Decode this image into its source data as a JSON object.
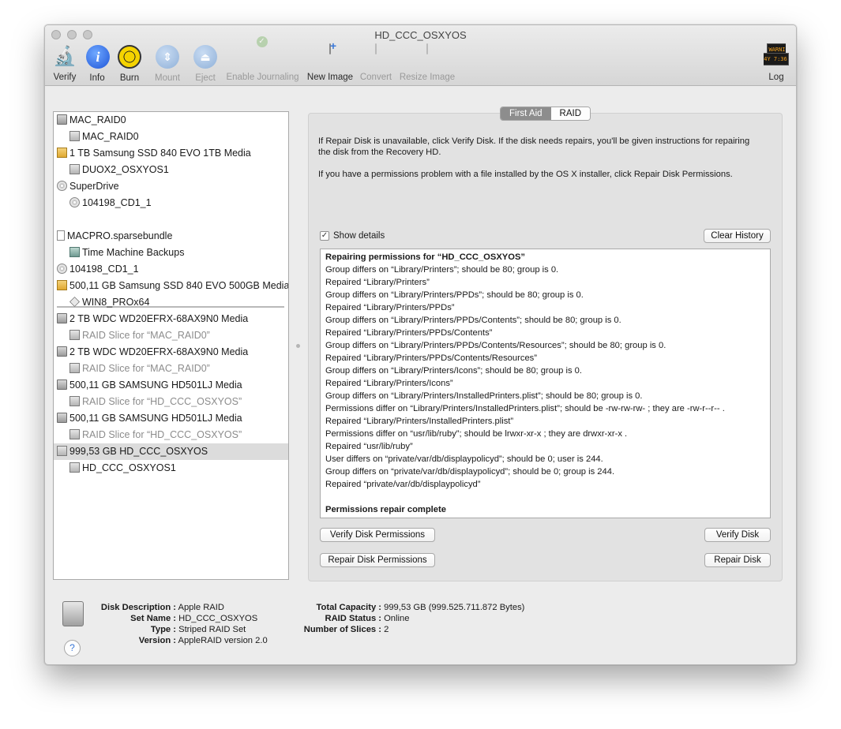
{
  "window": {
    "title": "HD_CCC_OSXYOS"
  },
  "toolbar": {
    "verify": "Verify",
    "info": "Info",
    "burn": "Burn",
    "mount": "Mount",
    "eject": "Eject",
    "enable_journaling": "Enable Journaling",
    "new_image": "New Image",
    "convert": "Convert",
    "resize_image": "Resize Image",
    "log": "Log",
    "log_icon_text": "WARNI\n4Y 7:36"
  },
  "sidebar": {
    "items": [
      {
        "label": "MAC_RAID0",
        "icon": "hard-disk-icon"
      },
      {
        "label": "MAC_RAID0",
        "icon": "volume-icon"
      },
      {
        "label": "1 TB Samsung SSD 840 EVO 1TB Media",
        "icon": "ssd-icon"
      },
      {
        "label": "DUOX2_OSXYOS1",
        "icon": "volume-icon"
      },
      {
        "label": "SuperDrive",
        "icon": "optical-drive-icon"
      },
      {
        "label": "104198_CD1_1",
        "icon": "cd-icon"
      },
      {
        "label": "MACPRO.sparsebundle",
        "icon": "disk-image-icon"
      },
      {
        "label": "Time Machine Backups",
        "icon": "time-machine-icon"
      },
      {
        "label": "104198_CD1_1",
        "icon": "cd-icon"
      },
      {
        "label": "500,11 GB Samsung SSD 840 EVO 500GB Media",
        "icon": "ssd-icon"
      },
      {
        "label": "WIN8_PROx64",
        "icon": "windows-volume-icon"
      },
      {
        "label": "2 TB WDC WD20EFRX-68AX9N0 Media",
        "icon": "hard-disk-icon"
      },
      {
        "label": "RAID Slice for “MAC_RAID0”",
        "icon": "volume-icon"
      },
      {
        "label": "2 TB WDC WD20EFRX-68AX9N0 Media",
        "icon": "hard-disk-icon"
      },
      {
        "label": "RAID Slice for “MAC_RAID0”",
        "icon": "volume-icon"
      },
      {
        "label": "500,11 GB SAMSUNG HD501LJ Media",
        "icon": "hard-disk-icon"
      },
      {
        "label": "RAID Slice for “HD_CCC_OSXYOS”",
        "icon": "volume-icon"
      },
      {
        "label": "500,11 GB SAMSUNG HD501LJ Media",
        "icon": "hard-disk-icon"
      },
      {
        "label": "RAID Slice for “HD_CCC_OSXYOS”",
        "icon": "volume-icon"
      },
      {
        "label": "999,53 GB HD_CCC_OSXYOS",
        "icon": "raid-icon"
      },
      {
        "label": "HD_CCC_OSXYOS1",
        "icon": "volume-icon"
      }
    ]
  },
  "tabs": {
    "first_aid": "First Aid",
    "raid": "RAID"
  },
  "first_aid": {
    "info_text_1": "If Repair Disk is unavailable, click Verify Disk. If the disk needs repairs, you'll be given instructions for repairing the disk from the Recovery HD.",
    "info_text_2": "If you have a permissions problem with a file installed by the OS X installer, click Repair Disk Permissions.",
    "show_details": "Show details",
    "clear_history": "Clear History",
    "log_lines": [
      "Repairing permissions for “HD_CCC_OSXYOS”",
      "Group differs on “Library/Printers”; should be 80; group is 0.",
      "Repaired “Library/Printers”",
      "Group differs on “Library/Printers/PPDs”; should be 80; group is 0.",
      "Repaired “Library/Printers/PPDs”",
      "Group differs on “Library/Printers/PPDs/Contents”; should be 80; group is 0.",
      "Repaired “Library/Printers/PPDs/Contents”",
      "Group differs on “Library/Printers/PPDs/Contents/Resources”; should be 80; group is 0.",
      "Repaired “Library/Printers/PPDs/Contents/Resources”",
      "Group differs on “Library/Printers/Icons”; should be 80; group is 0.",
      "Repaired “Library/Printers/Icons”",
      "Group differs on “Library/Printers/InstalledPrinters.plist”; should be 80; group is 0.",
      "Permissions differ on “Library/Printers/InstalledPrinters.plist”; should be -rw-rw-rw- ; they are -rw-r--r-- .",
      "Repaired “Library/Printers/InstalledPrinters.plist”",
      "Permissions differ on “usr/lib/ruby”; should be lrwxr-xr-x ; they are drwxr-xr-x .",
      "Repaired “usr/lib/ruby”",
      "User differs on “private/var/db/displaypolicyd”; should be 0; user is 244.",
      "Group differs on “private/var/db/displaypolicyd”; should be 0; group is 244.",
      "Repaired “private/var/db/displaypolicyd”",
      "",
      "Permissions repair complete"
    ],
    "verify_disk_permissions": "Verify Disk Permissions",
    "verify_disk": "Verify Disk",
    "repair_disk_permissions": "Repair Disk Permissions",
    "repair_disk": "Repair Disk"
  },
  "details": {
    "disk_description_label": "Disk Description :",
    "disk_description": "Apple RAID",
    "set_name_label": "Set Name :",
    "set_name": "HD_CCC_OSXYOS",
    "type_label": "Type :",
    "type": "Striped RAID Set",
    "version_label": "Version :",
    "version": "AppleRAID version 2.0",
    "total_capacity_label": "Total Capacity :",
    "total_capacity": "999,53 GB (999.525.711.872 Bytes)",
    "raid_status_label": "RAID Status :",
    "raid_status": "Online",
    "number_of_slices_label": "Number of Slices :",
    "number_of_slices": "2"
  },
  "help": {
    "label": "?"
  }
}
